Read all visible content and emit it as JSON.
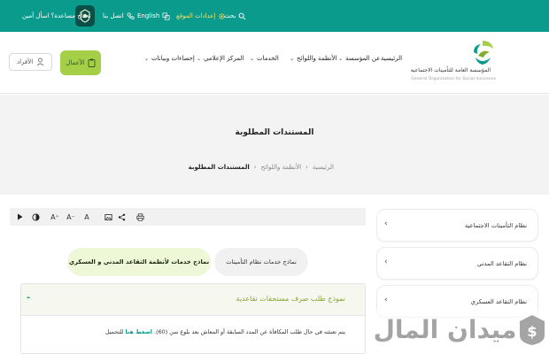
{
  "topbar": {
    "help": "تحتاج مساعدة؟ اسأل أمين",
    "contact": "اتصل بنا",
    "language": "English",
    "site_settings": "إعدادات الموقع",
    "search": "بحث"
  },
  "header": {
    "individuals": "الأفراد",
    "business": "الأعمال",
    "logo_ar": "المؤسسة العامة للتأمينات الاجتماعية",
    "logo_en": "General Organization for Social Insurance",
    "nav": [
      "الرئيسية",
      "عن المؤسسة",
      "الأنظمة واللوائح",
      "الخدمات",
      "المركز الإعلامي",
      "إحصاءات وبيانات"
    ]
  },
  "banner": {
    "title": "المستندات المطلوبة",
    "breadcrumb": [
      "الرئيسية",
      "الأنظمة واللوائح",
      "المستندات المطلوبة"
    ]
  },
  "toolbar": {
    "tools": [
      "play-icon",
      "contrast-icon",
      "font-increase-icon",
      "font-decrease-icon",
      "font-reset-icon",
      "image-toggle-icon",
      "share-icon",
      "print-icon"
    ]
  },
  "tabs": [
    {
      "label": "نماذج خدمات نظام التأمينات",
      "active": false
    },
    {
      "label": "نماذج خدمات لأنظمة التقاعد المدني و العسكري",
      "active": true
    }
  ],
  "accordion": {
    "title": "نموذج طلب صرف مستحقات تقاعدية",
    "toggle": "-",
    "body_text": "يتم تعبئته في حال طلب المكافأة عن المدد السابقة أو المعاش بعد بلوغ سن (60).",
    "link_text": "اضغط هنا",
    "body_tail": "للتحميل"
  },
  "side_menu": [
    {
      "label": "نظام التأمينات الاجتماعية"
    },
    {
      "label": "نظام التقاعد المدني"
    },
    {
      "label": "نظام التقاعد العسكري"
    }
  ],
  "watermark": {
    "text": "ميدان المال"
  },
  "colors": {
    "teal": "#0a9b8c",
    "lime": "#a4cf46",
    "banner": "#f3f3f3"
  }
}
